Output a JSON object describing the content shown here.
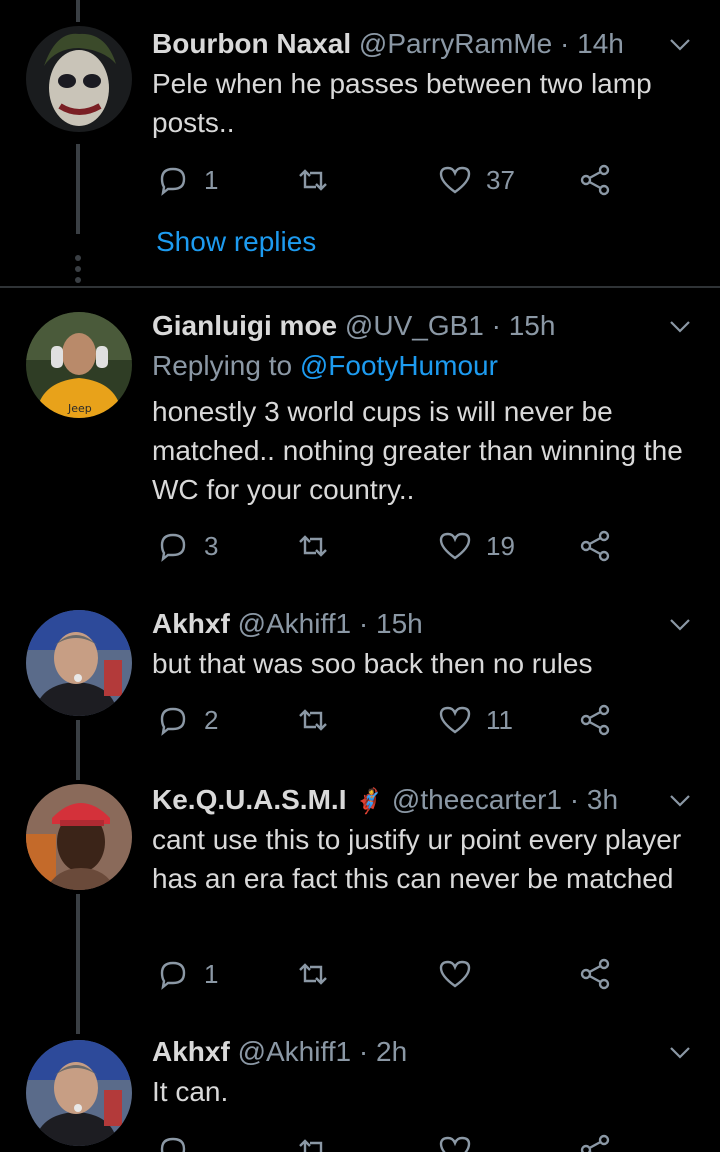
{
  "colors": {
    "background": "#000000",
    "text": "#d9d9d9",
    "secondary": "#8b98a5",
    "accent": "#1d9bf0",
    "divider": "#2f3336"
  },
  "icons": {
    "reply": "speech-bubble-icon",
    "retweet": "retweet-icon",
    "like": "heart-icon",
    "share": "share-icon",
    "more": "chevron-down-icon"
  },
  "tweets": [
    {
      "name": "Bourbon Naxal",
      "handle": "@ParryRamMe",
      "dot": "·",
      "time": "14h",
      "text": "Pele when he passes between two lamp posts..",
      "replies": "1",
      "retweets": "",
      "likes": "37",
      "show_replies": "Show replies"
    },
    {
      "name": "Gianluigi moe",
      "handle": "@UV_GB1",
      "dot": "·",
      "time": "15h",
      "reply_prefix": "Replying to",
      "reply_mention": "@FootyHumour",
      "text": "honestly 3 world cups is will never be matched.. nothing greater than winning the WC for your country..",
      "replies": "3",
      "retweets": "",
      "likes": "19",
      "avatar_logo": "Jeep"
    },
    {
      "name": "Akhxf",
      "handle": "@Akhiff1",
      "dot": "·",
      "time": "15h",
      "text": "but that was soo back then no rules",
      "replies": "2",
      "retweets": "",
      "likes": "11"
    },
    {
      "name": "Ke.Q.U.A.S.M.I",
      "name_emoji": "🦸",
      "handle": "@theecarter1",
      "dot": "·",
      "time": "3h",
      "text": "cant use this to justify ur point every player has an era fact this can never be matched",
      "replies": "1",
      "retweets": "",
      "likes": ""
    },
    {
      "name": "Akhxf",
      "handle": "@Akhiff1",
      "dot": "·",
      "time": "2h",
      "text": "It can.",
      "replies": "",
      "retweets": "",
      "likes": ""
    }
  ]
}
